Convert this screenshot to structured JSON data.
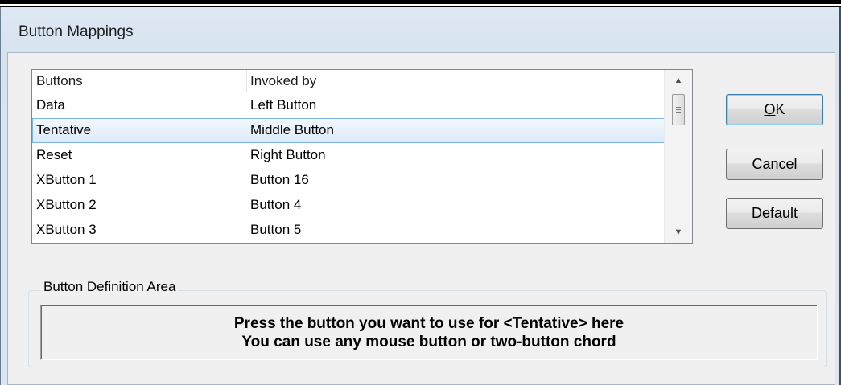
{
  "dialog": {
    "title": "Button Mappings"
  },
  "list": {
    "headers": {
      "buttons": "Buttons",
      "invoked_by": "Invoked by"
    },
    "rows": [
      {
        "button": "Data",
        "invoked_by": "Left Button"
      },
      {
        "button": "Tentative",
        "invoked_by": "Middle Button"
      },
      {
        "button": "Reset",
        "invoked_by": "Right Button"
      },
      {
        "button": "XButton 1",
        "invoked_by": "Button 16"
      },
      {
        "button": "XButton 2",
        "invoked_by": "Button 4"
      },
      {
        "button": "XButton 3",
        "invoked_by": "Button 5"
      }
    ],
    "selected_row": "Tentative",
    "scroll_icons": {
      "up": "up-arrow-icon",
      "down": "down-arrow-icon"
    }
  },
  "buttons": {
    "ok_accel": "O",
    "ok_rest": "K",
    "cancel": "Cancel",
    "default_accel": "D",
    "default_rest": "efault"
  },
  "definition_area": {
    "label": "Button Definition Area",
    "line1": "Press the button you want to use for <Tentative> here",
    "line2": "You can use any mouse button or two-button chord"
  }
}
